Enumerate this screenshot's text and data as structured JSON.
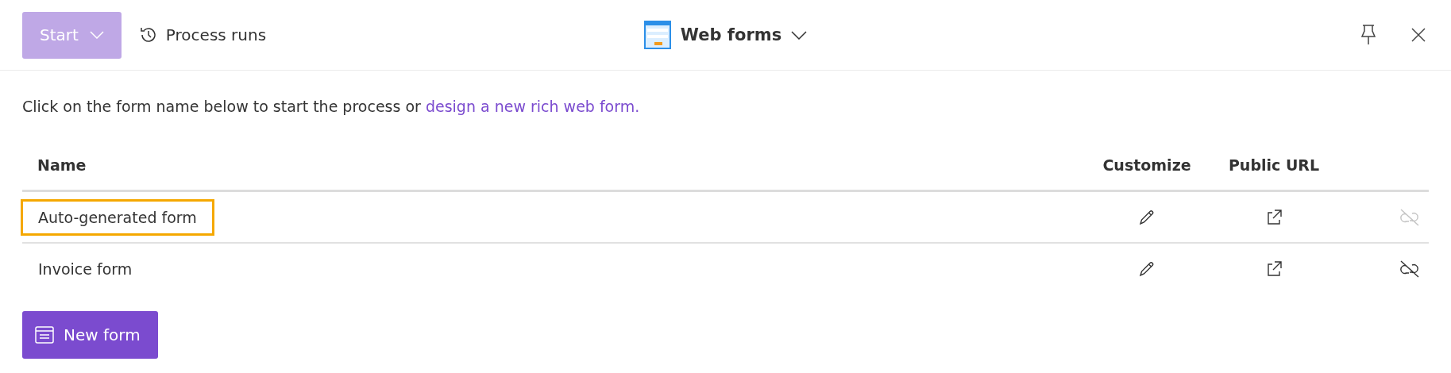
{
  "toolbar": {
    "start_button": {
      "label": "Start",
      "disabled": true
    },
    "process_runs": {
      "label": "Process runs"
    },
    "title": "Web forms"
  },
  "intro": {
    "text": "Click on the form name below to start the process or",
    "link": "design a new rich web form."
  },
  "table": {
    "columns": [
      "Name",
      "Customize",
      "Public URL"
    ],
    "rows": [
      {
        "name": "Auto-generated form",
        "selected": true,
        "unlink_disabled": true
      },
      {
        "name": "Invoice form",
        "selected": false,
        "unlink_disabled": false
      }
    ]
  },
  "new_form_button": {
    "label": "New form"
  }
}
